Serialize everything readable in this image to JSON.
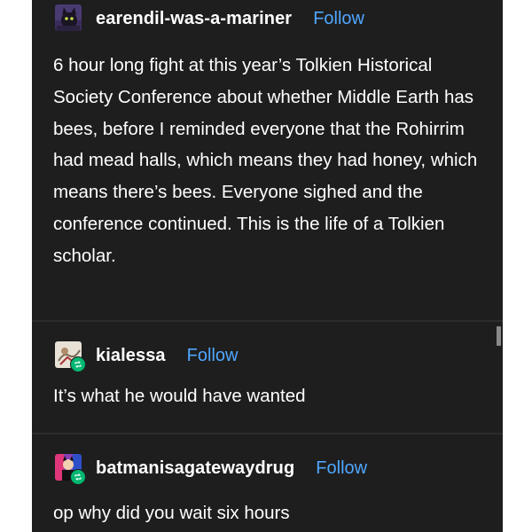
{
  "posts": [
    {
      "username": "earendil-was-a-mariner",
      "follow_label": "Follow",
      "text": "6 hour long fight at this year’s Tolkien Historical Society Conference about whether Middle Earth has bees, before I reminded everyone that the Rohirrim had mead halls, which means they had honey, which means there’s bees. Everyone sighed and the conference continued. This is the life of a Tolkien scholar.",
      "avatar_icon": "cat-avatar-icon"
    },
    {
      "username": "kialessa",
      "follow_label": "Follow",
      "text": "It’s what he would have wanted",
      "avatar_icon": "sketch-avatar-icon",
      "reblog_icon": "reblog-icon"
    },
    {
      "username": "batmanisagatewaydrug",
      "follow_label": "Follow",
      "text": "op why did you wait six hours",
      "avatar_icon": "batman-avatar-icon",
      "reblog_icon": "reblog-icon"
    }
  ],
  "colors": {
    "background": "#1e1e1e",
    "text": "#ffffff",
    "follow": "#4fa7ff",
    "reblog_badge": "#00b871"
  }
}
